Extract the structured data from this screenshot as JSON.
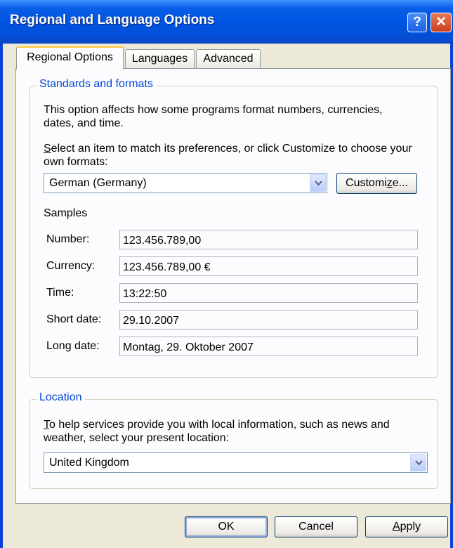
{
  "window": {
    "title": "Regional and Language Options",
    "help_glyph": "?",
    "close_glyph": "✕"
  },
  "tabs": [
    {
      "label": "Regional Options",
      "active": true
    },
    {
      "label": "Languages",
      "active": false
    },
    {
      "label": "Advanced",
      "active": false
    }
  ],
  "standards": {
    "legend": "Standards and formats",
    "description": "This option affects how some programs format numbers, currencies, dates, and time.",
    "select_prompt_access_key": "S",
    "select_prompt_rest": "elect an item to match its preferences, or click Customize to choose your own formats:",
    "format_value": "German (Germany)",
    "customize_before": "Customi",
    "customize_key": "z",
    "customize_after": "e...",
    "samples_heading": "Samples",
    "samples": [
      {
        "label": "Number:",
        "value": "123.456.789,00"
      },
      {
        "label": "Currency:",
        "value": "123.456.789,00 €"
      },
      {
        "label": "Time:",
        "value": "13:22:50"
      },
      {
        "label": "Short date:",
        "value": "29.10.2007"
      },
      {
        "label": "Long date:",
        "value": "Montag, 29. Oktober 2007"
      }
    ]
  },
  "location": {
    "legend": "Location",
    "prompt_access_key": "T",
    "prompt_rest": "o help services provide you with local information, such as news and weather, select your present location:",
    "value": "United Kingdom"
  },
  "footer": {
    "ok_label": "OK",
    "cancel_label": "Cancel",
    "apply_key": "A",
    "apply_rest": "pply"
  },
  "colors": {
    "titlebar": "#0054e3",
    "legend_text": "#0046d5",
    "dialog_bg": "#ece9d8",
    "panel_bg": "#fcfcfe"
  }
}
